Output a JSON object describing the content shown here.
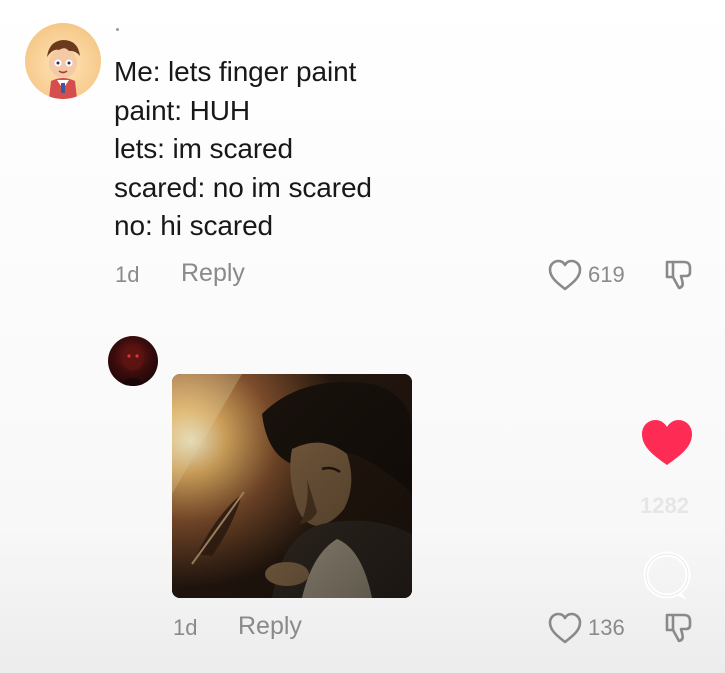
{
  "comments": [
    {
      "author_avatar": "cartoon-boy-avatar",
      "lines": [
        "Me: lets finger paint",
        "paint: HUH",
        "lets: im scared",
        "scared: no im scared",
        "no: hi scared"
      ],
      "time": "1d",
      "reply_label": "Reply",
      "like_count": "619"
    },
    {
      "author_avatar": "dark-red-avatar",
      "attachment": "dark-illustration-image",
      "time": "1d",
      "reply_label": "Reply",
      "like_count": "136"
    }
  ],
  "overlay": {
    "like_color": "#fe2c55",
    "faded_count": "1282"
  },
  "colors": {
    "meta_text": "#8a8a8a",
    "body_text": "#181818",
    "background": "#fbfbfb"
  }
}
